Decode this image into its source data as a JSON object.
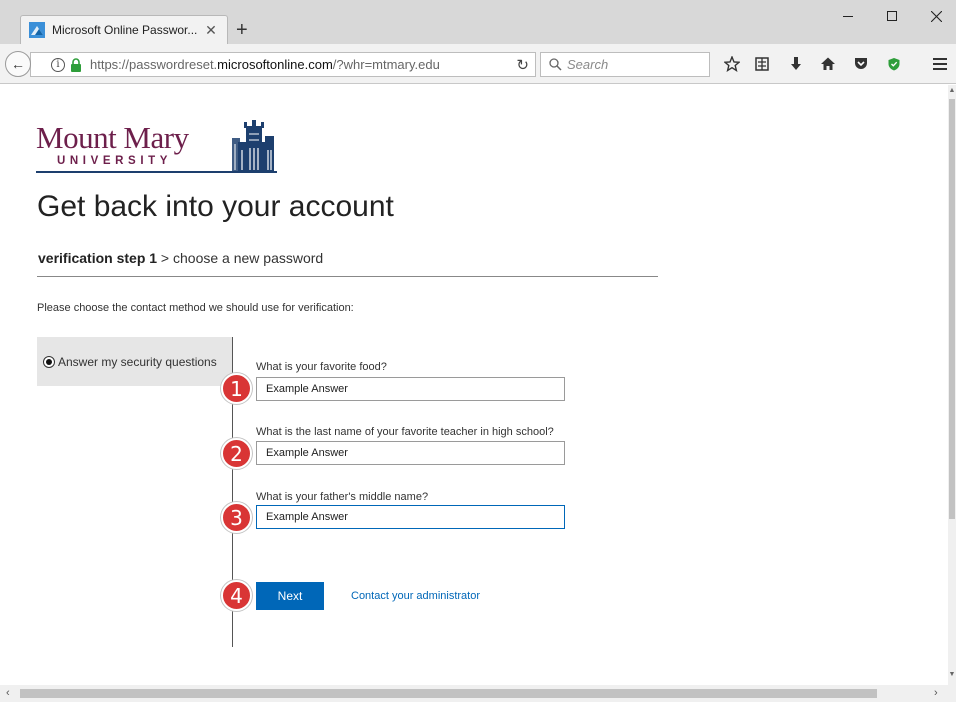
{
  "browser": {
    "tab_title": "Microsoft Online Passwor...",
    "tab_close": "✕",
    "new_tab": "+",
    "url": {
      "prefix": "https://passwordreset.",
      "host": "microsoftonline.com",
      "suffix": "/?whr=mtmary.edu"
    },
    "search_placeholder": "Search",
    "back_glyph": "←",
    "reload_glyph": "↻",
    "icons": [
      "star-icon",
      "reading-list-icon",
      "download-icon",
      "home-icon",
      "pocket-icon",
      "shield-icon",
      "menu-icon"
    ]
  },
  "page": {
    "logo": {
      "name": "Mount Mary",
      "sub": "UNIVERSITY"
    },
    "title": "Get back into your account",
    "steps": {
      "current": "verification step 1",
      "separator": " > ",
      "next": "choose a new password"
    },
    "instructions": "Please choose the contact method we should use for verification:",
    "method_option": "Answer my security questions",
    "questions": [
      {
        "label": "What is your favorite food?",
        "value": "Example Answer",
        "badge": "1"
      },
      {
        "label": "What is the last name of your favorite teacher in high school?",
        "value": "Example Answer",
        "badge": "2"
      },
      {
        "label": "What is your father's middle name?",
        "value": "Example Answer",
        "badge": "3"
      }
    ],
    "next_button": "Next",
    "next_badge": "4",
    "contact_link": "Contact your administrator"
  },
  "colors": {
    "brand_maroon": "#6d1f4b",
    "brand_navy": "#1d3f6e",
    "accent_blue": "#0067b8",
    "badge_red": "#d93535"
  }
}
